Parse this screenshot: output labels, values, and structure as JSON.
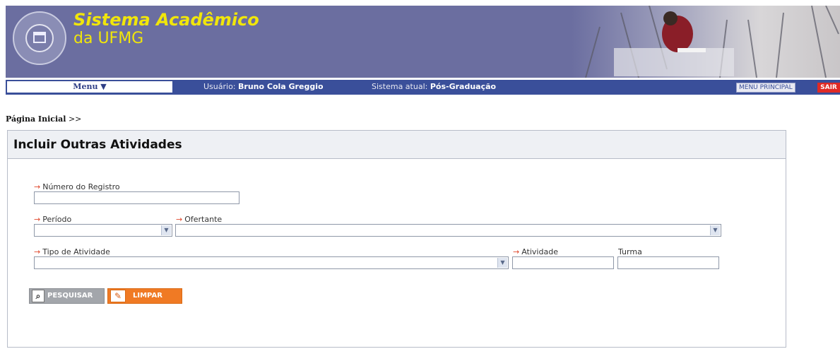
{
  "header": {
    "title_line1": "Sistema Acadêmico",
    "title_line2": "da UFMG"
  },
  "nav": {
    "menu_label": "Menu ▼",
    "user_label": "Usuário:",
    "user_name": "Bruno Cola Greggio",
    "system_label": "Sistema atual:",
    "system_name": "Pós-Graduação",
    "menu_principal": "MENU PRINCIPAL",
    "sair": "SAIR"
  },
  "breadcrumb": {
    "home": "Página Inicial",
    "separator": ">>"
  },
  "form": {
    "title": "Incluir Outras Atividades",
    "numero_registro": {
      "label": "Número do Registro",
      "value": ""
    },
    "periodo": {
      "label": "Período",
      "value": ""
    },
    "ofertante": {
      "label": "Ofertante",
      "value": ""
    },
    "tipo_atividade": {
      "label": "Tipo de Atividade",
      "value": ""
    },
    "atividade": {
      "label": "Atividade",
      "value": ""
    },
    "turma": {
      "label": "Turma",
      "value": ""
    },
    "required_marker": "→"
  },
  "buttons": {
    "pesquisar": "PESQUISAR",
    "limpar": "LIMPAR",
    "search_icon": "magnifier-icon",
    "clear_icon": "eraser-icon"
  },
  "colors": {
    "banner": "#6b6ea0",
    "title": "#f1e60a",
    "navbar": "#3a4f9a",
    "sair": "#e02a25",
    "limpar": "#f07a24",
    "required_arrow": "#e0472b"
  }
}
